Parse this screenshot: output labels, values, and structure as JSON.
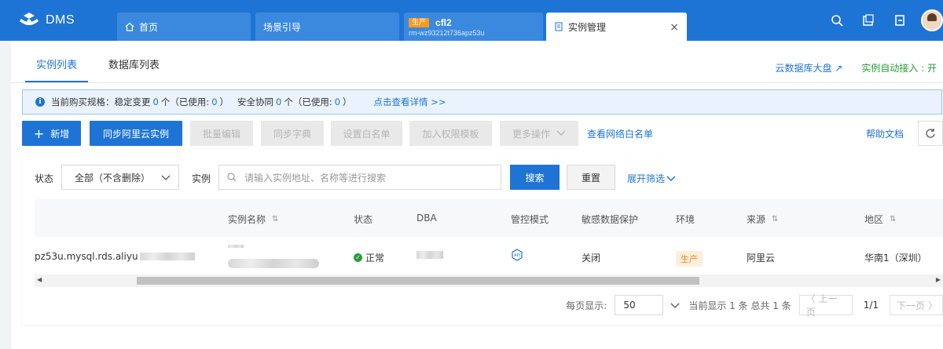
{
  "app": {
    "name": "DMS"
  },
  "tabs": [
    {
      "label": "首页"
    },
    {
      "label": "场景引导"
    },
    {
      "env": "生产",
      "name": "cfl2",
      "sub": "rm-wz93212t736apz53u"
    },
    {
      "label": "实例管理",
      "close": "×"
    }
  ],
  "subnav": {
    "tabs": [
      "实例列表",
      "数据库列表"
    ],
    "link_dashboard": "云数据库大盘 ↗",
    "link_auto": "实例自动接入 : 开"
  },
  "notice": {
    "prefix": "当前购买规格：稳定变更",
    "stable_count": "0",
    "unit1": "个（已使用:",
    "stable_used": "0",
    "mid": "）   安全协同",
    "secure_count": "0",
    "unit2": "个（已使用:",
    "secure_used": "0",
    "end": "）",
    "link": "点击查看详情 >>"
  },
  "toolbar": {
    "add": "新增",
    "sync": "同步阿里云实例",
    "batch_edit": "批量编辑",
    "sync_dict": "同步字典",
    "set_whitelist": "设置白名单",
    "add_perm": "加入权限模板",
    "more": "更多操作",
    "view_whitelist": "查看网络白名单",
    "help": "帮助文档"
  },
  "filter": {
    "status_label": "状态",
    "status_value": "全部（不含删除）",
    "instance_label": "实例",
    "search_placeholder": "请输入实例地址、名称等进行搜索",
    "search_btn": "搜索",
    "reset_btn": "重置",
    "expand": "展开筛选"
  },
  "table": {
    "columns": [
      "实例名称",
      "状态",
      "DBA",
      "管控模式",
      "敏感数据保护",
      "环境",
      "来源",
      "地区"
    ],
    "rows": [
      {
        "address": "pz53u.mysql.rds.aliyu",
        "status": "正常",
        "sensitive": "关闭",
        "env": "生产",
        "source": "阿里云",
        "region": "华南1（深圳）"
      }
    ]
  },
  "pager": {
    "per_page_label": "每页显示:",
    "per_page": "50",
    "summary": "当前显示 1 条 总共 1 条",
    "prev": "〈 上一页",
    "page": "1/1",
    "next": "下一页 〉"
  },
  "colors": {
    "primary": "#1e74d4",
    "ok": "#2a9d3a",
    "env": "#f59a23"
  }
}
